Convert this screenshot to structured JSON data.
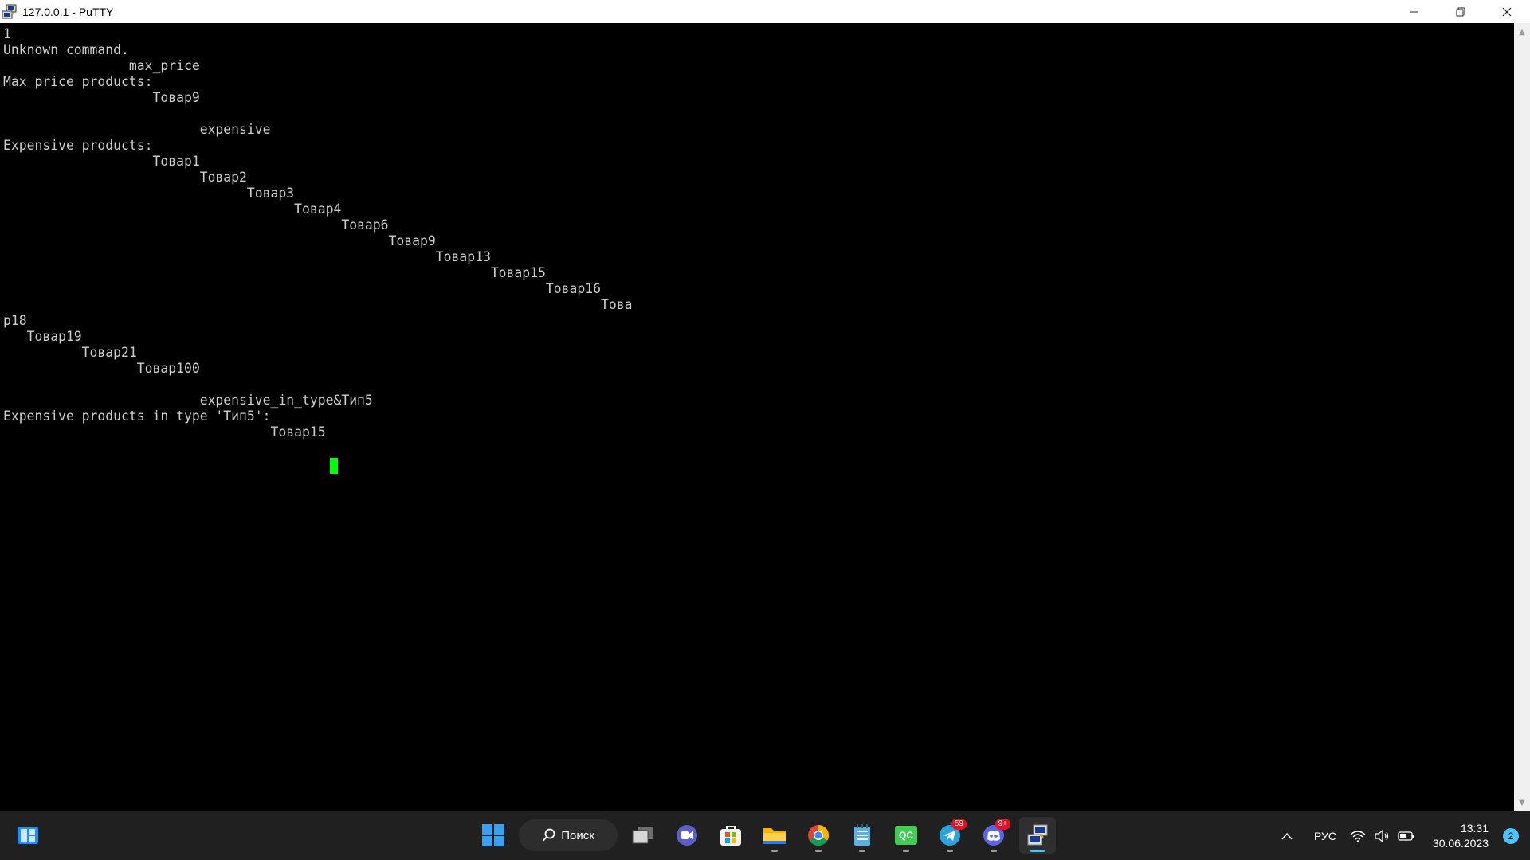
{
  "window": {
    "title": "127.0.0.1 - PuTTY",
    "controls": {
      "minimize": "—",
      "restore": "❐",
      "close": "✕"
    }
  },
  "terminal": {
    "lines": [
      "1",
      "Unknown command.",
      "                max_price",
      "Max price products:",
      "                   Товар9",
      "",
      "                         expensive",
      "Expensive products:",
      "                   Товар1",
      "                         Товар2",
      "                               Товар3",
      "                                     Товар4",
      "                                           Товар6",
      "                                                 Товар9",
      "                                                       Товар13",
      "                                                              Товар15",
      "                                                                     Товар16",
      "                                                                            Това",
      "р18",
      "   Товар19",
      "          Товар21",
      "                 Товар100",
      "",
      "                         expensive_in_type&Тип5",
      "Expensive products in type 'Тип5':",
      "                                  Товар15"
    ],
    "cursor_color": "#00ff00",
    "text_color": "#cfcfcf",
    "background": "#000000"
  },
  "taskbar": {
    "search_label": "Поиск",
    "apps": [
      {
        "name": "widgets",
        "icon": "widgets-icon"
      },
      {
        "name": "start",
        "icon": "windows-start-icon"
      },
      {
        "name": "task-view",
        "icon": "task-view-icon"
      },
      {
        "name": "teams-chat",
        "icon": "chat-icon"
      },
      {
        "name": "store",
        "icon": "store-icon"
      },
      {
        "name": "file-explorer",
        "icon": "folder-icon"
      },
      {
        "name": "chrome",
        "icon": "chrome-icon"
      },
      {
        "name": "notepad",
        "icon": "notepad-icon"
      },
      {
        "name": "qt-creator",
        "icon": "qt-creator-icon",
        "label": "QC"
      },
      {
        "name": "telegram",
        "icon": "telegram-icon",
        "badge": "59"
      },
      {
        "name": "discord",
        "icon": "discord-icon",
        "badge": "9+"
      },
      {
        "name": "putty",
        "icon": "putty-icon"
      }
    ],
    "tray": {
      "overflow": "^",
      "language": "РУС",
      "time": "13:31",
      "date": "30.06.2023",
      "notifications": "2"
    }
  }
}
